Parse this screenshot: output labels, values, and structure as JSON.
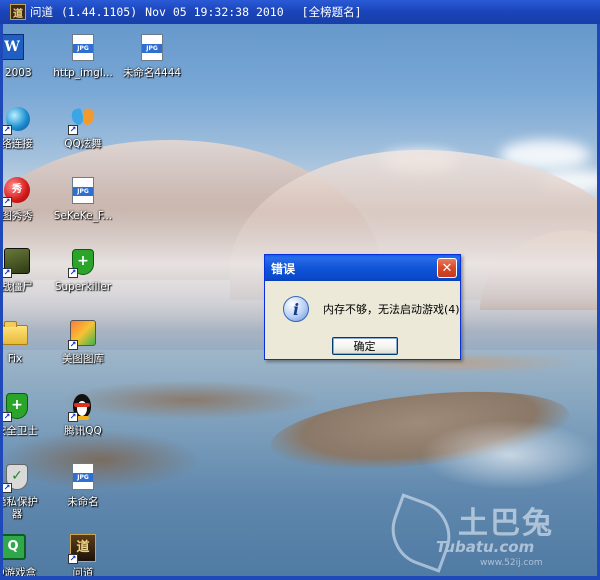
{
  "titlebar": {
    "app_name": "问道",
    "version": "(1.44.1105)",
    "datetime": "Nov 05 19:32:38 2010",
    "rank": "[全榜题名]"
  },
  "desktop": {
    "icons": [
      {
        "label": "rl 2003",
        "icon": "word-document-icon"
      },
      {
        "label": "http_imgl...",
        "icon": "jpg-file-icon"
      },
      {
        "label": "未命名4444",
        "icon": "jpg-file-icon"
      },
      {
        "label": "络连接",
        "icon": "network-globe-icon"
      },
      {
        "label": "QQ炫舞",
        "icon": "qq-dance-butterfly-icon"
      },
      {
        "label": "图秀秀",
        "icon": "meitu-xiuxiu-icon"
      },
      {
        "label": "SeKeKe_F...",
        "icon": "jpg-file-icon"
      },
      {
        "label": "战僵尸",
        "icon": "zombie-game-icon"
      },
      {
        "label": "Superkiller",
        "icon": "superkiller-icon"
      },
      {
        "label": "Fix",
        "icon": "folder-icon"
      },
      {
        "label": "美图图库",
        "icon": "meitu-gallery-icon"
      },
      {
        "label": "安全卫士",
        "icon": "security-shield-icon"
      },
      {
        "label": "腾讯QQ",
        "icon": "qq-penguin-icon"
      },
      {
        "label": "隐私保护\n器",
        "icon": "privacy-shield-icon"
      },
      {
        "label": "未命名",
        "icon": "jpg-file-icon"
      },
      {
        "label": "Q9游戏盒",
        "icon": "q9-game-box-icon"
      },
      {
        "label": "问道",
        "icon": "wendao-game-icon"
      }
    ]
  },
  "dialog": {
    "title": "错误",
    "message": "内存不够，无法启动游戏(4)",
    "ok_label": "确定",
    "close_glyph": "✕",
    "info_glyph": "i"
  },
  "watermark": {
    "cn": "土巴兔",
    "en": "Tubatu.com",
    "url": "www.52ij.com"
  },
  "colors": {
    "titlebar_blue": "#1f49b8",
    "dialog_face": "#ece9d8",
    "close_red": "#d8492a"
  }
}
